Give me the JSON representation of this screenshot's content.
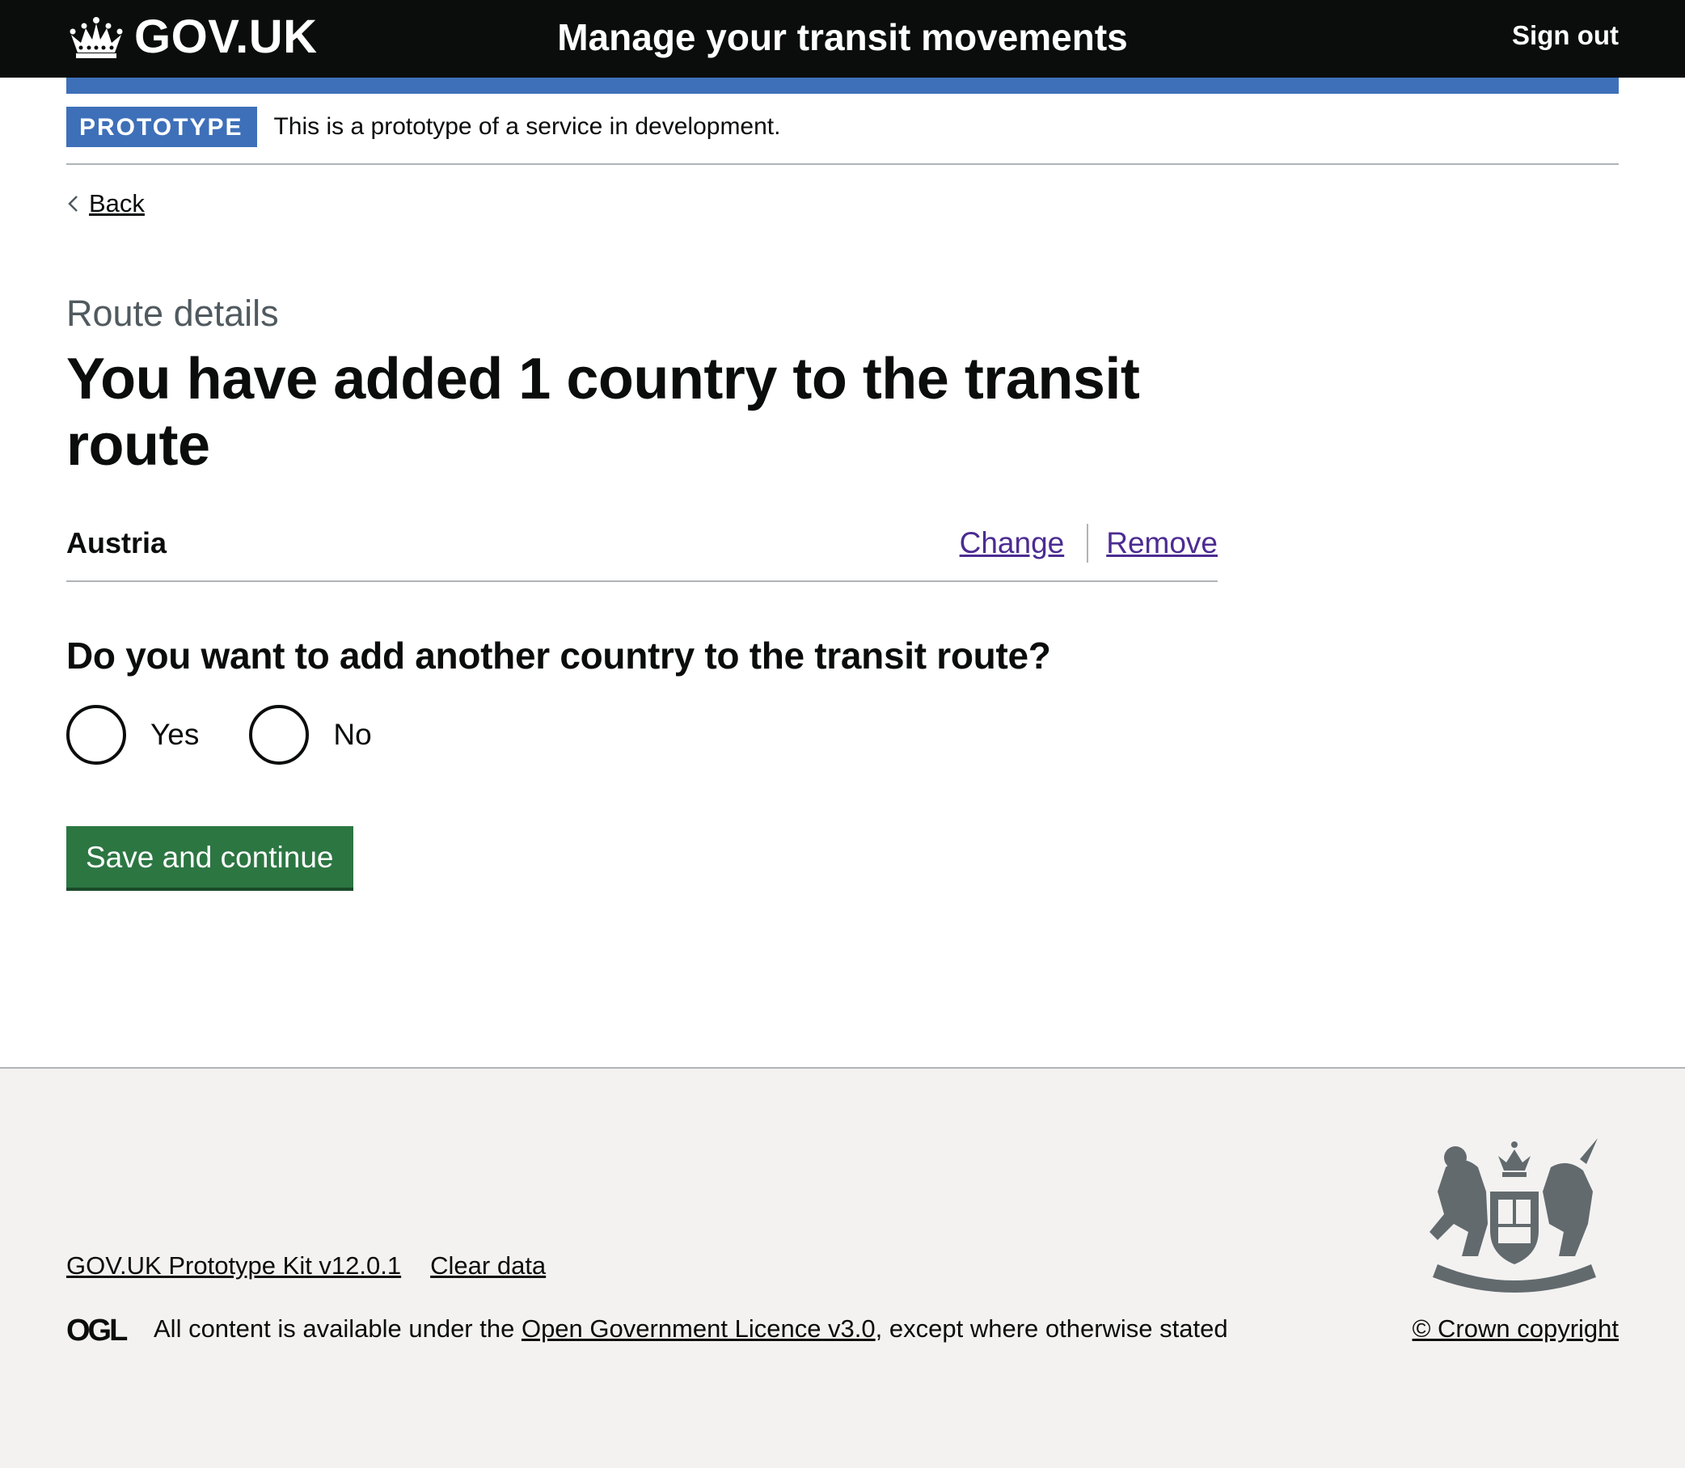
{
  "header": {
    "logo_text": "GOV.UK",
    "service_name": "Manage your transit movements",
    "sign_out": "Sign out"
  },
  "phase_banner": {
    "tag": "PROTOTYPE",
    "text": "This is a prototype of a service in development."
  },
  "back_link": "Back",
  "caption": "Route details",
  "heading": "You have added 1 country to the transit route",
  "summary_list": {
    "items": [
      {
        "name": "Austria",
        "change": "Change",
        "remove": "Remove"
      }
    ]
  },
  "question": "Do you want to add another country to the transit route?",
  "radios": [
    {
      "label": "Yes",
      "checked": false
    },
    {
      "label": "No",
      "checked": false
    }
  ],
  "submit_button": "Save and continue",
  "footer": {
    "links": [
      "GOV.UK Prototype Kit v12.0.1",
      "Clear data"
    ],
    "licence_prefix": "All content is available under the ",
    "licence_link": "Open Government Licence v3.0",
    "licence_suffix": ", except where otherwise stated",
    "copyright": "© Crown copyright",
    "ogl_logo_text": "OGL"
  },
  "colors": {
    "header_bg": "#0b0c0c",
    "accent_blue": "#3e70b9",
    "button_green": "#2c7642",
    "link_purple": "#4c2c92",
    "footer_bg": "#f3f2f1"
  }
}
